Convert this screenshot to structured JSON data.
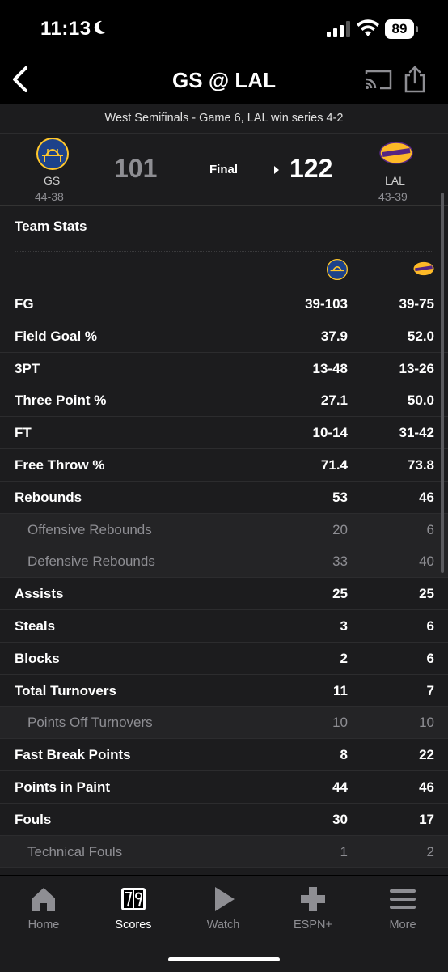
{
  "status_bar": {
    "time": "11:13",
    "battery": "89"
  },
  "nav": {
    "title": "GS @ LAL"
  },
  "series_text": "West Semifinals - Game 6, LAL win series 4-2",
  "game": {
    "away": {
      "abbr": "GS",
      "record": "44-38",
      "score": "101"
    },
    "home": {
      "abbr": "LAL",
      "record": "43-39",
      "score": "122"
    },
    "status": "Final"
  },
  "team_stats": {
    "heading": "Team Stats",
    "rows": [
      {
        "label": "FG",
        "away": "39-103",
        "home": "39-75",
        "sub": false
      },
      {
        "label": "Field Goal %",
        "away": "37.9",
        "home": "52.0",
        "sub": false
      },
      {
        "label": "3PT",
        "away": "13-48",
        "home": "13-26",
        "sub": false
      },
      {
        "label": "Three Point %",
        "away": "27.1",
        "home": "50.0",
        "sub": false
      },
      {
        "label": "FT",
        "away": "10-14",
        "home": "31-42",
        "sub": false
      },
      {
        "label": "Free Throw %",
        "away": "71.4",
        "home": "73.8",
        "sub": false
      },
      {
        "label": "Rebounds",
        "away": "53",
        "home": "46",
        "sub": false
      },
      {
        "label": "Offensive Rebounds",
        "away": "20",
        "home": "6",
        "sub": true
      },
      {
        "label": "Defensive Rebounds",
        "away": "33",
        "home": "40",
        "sub": true
      },
      {
        "label": "Assists",
        "away": "25",
        "home": "25",
        "sub": false
      },
      {
        "label": "Steals",
        "away": "3",
        "home": "6",
        "sub": false
      },
      {
        "label": "Blocks",
        "away": "2",
        "home": "6",
        "sub": false
      },
      {
        "label": "Total Turnovers",
        "away": "11",
        "home": "7",
        "sub": false
      },
      {
        "label": "Points Off Turnovers",
        "away": "10",
        "home": "10",
        "sub": true
      },
      {
        "label": "Fast Break Points",
        "away": "8",
        "home": "22",
        "sub": false
      },
      {
        "label": "Points in Paint",
        "away": "44",
        "home": "46",
        "sub": false
      },
      {
        "label": "Fouls",
        "away": "30",
        "home": "17",
        "sub": false
      },
      {
        "label": "Technical Fouls",
        "away": "1",
        "home": "2",
        "sub": true
      }
    ]
  },
  "tabbar": {
    "items": [
      {
        "label": "Home",
        "icon": "home-icon"
      },
      {
        "label": "Scores",
        "icon": "scores-icon",
        "active": true
      },
      {
        "label": "Watch",
        "icon": "play-icon"
      },
      {
        "label": "ESPN+",
        "icon": "plus-icon"
      },
      {
        "label": "More",
        "icon": "menu-icon"
      }
    ]
  },
  "colors": {
    "gs_blue": "#1D428A",
    "gs_gold": "#FFC72C",
    "lal_purple": "#552583",
    "lal_gold": "#FDB927"
  }
}
